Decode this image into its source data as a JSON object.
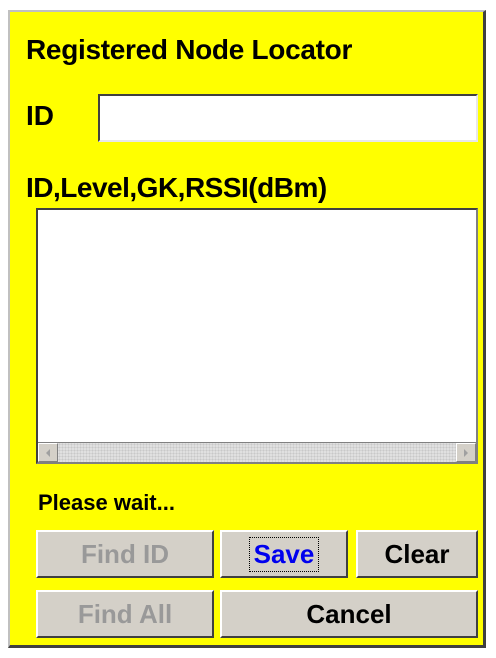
{
  "window": {
    "title": "Registered Node Locator"
  },
  "id_field": {
    "label": "ID",
    "value": ""
  },
  "list": {
    "header": "ID,Level,GK,RSSI(dBm)",
    "items": []
  },
  "status": "Please wait...",
  "buttons": {
    "find_id": "Find ID",
    "save": "Save",
    "clear": "Clear",
    "find_all": "Find All",
    "cancel": "Cancel"
  },
  "colors": {
    "background": "#ffff00",
    "button_face": "#d4d0c8",
    "disabled_text": "#999999",
    "focused_text": "#0000ee"
  },
  "icons": {
    "scroll_left": "triangle-left",
    "scroll_right": "triangle-right"
  }
}
